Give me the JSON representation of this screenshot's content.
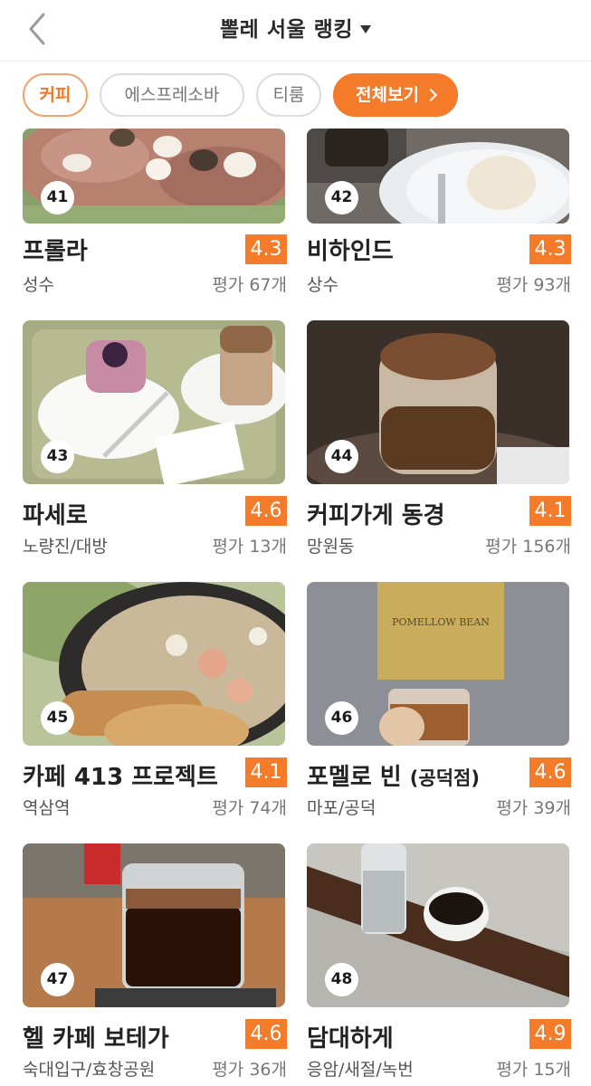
{
  "header": {
    "title": "뽈레 서울 랭킹"
  },
  "chips": [
    {
      "label": "커피"
    },
    {
      "label": "에스프레소바"
    },
    {
      "label": "티룸"
    },
    {
      "label": "전체보기"
    }
  ],
  "colors": {
    "accent": "#f47b2a",
    "chip_border": "#dcdcdc"
  },
  "cards": [
    {
      "rank": "41",
      "name": "프롤라",
      "area": "성수",
      "score": "4.3",
      "reviews": "평가 67개"
    },
    {
      "rank": "42",
      "name": "비하인드",
      "area": "상수",
      "score": "4.3",
      "reviews": "평가 93개"
    },
    {
      "rank": "43",
      "name": "파세로",
      "area": "노량진/대방",
      "score": "4.6",
      "reviews": "평가 13개"
    },
    {
      "rank": "44",
      "name": "커피가게 동경",
      "area": "망원동",
      "score": "4.1",
      "reviews": "평가 156개"
    },
    {
      "rank": "45",
      "name": "카페 413 프로젝트",
      "area": "역삼역",
      "score": "4.1",
      "reviews": "평가 74개"
    },
    {
      "rank": "46",
      "name": "포멜로 빈",
      "name_suffix": "(공덕점)",
      "area": "마포/공덕",
      "score": "4.6",
      "reviews": "평가 39개",
      "photo_sign": "POMELLOW BEAN"
    },
    {
      "rank": "47",
      "name": "헬 카페 보테가",
      "area": "숙대입구/효창공원",
      "score": "4.6",
      "reviews": "평가 36개"
    },
    {
      "rank": "48",
      "name": "담대하게",
      "area": "응암/새절/녹번",
      "score": "4.9",
      "reviews": "평가 15개"
    }
  ]
}
